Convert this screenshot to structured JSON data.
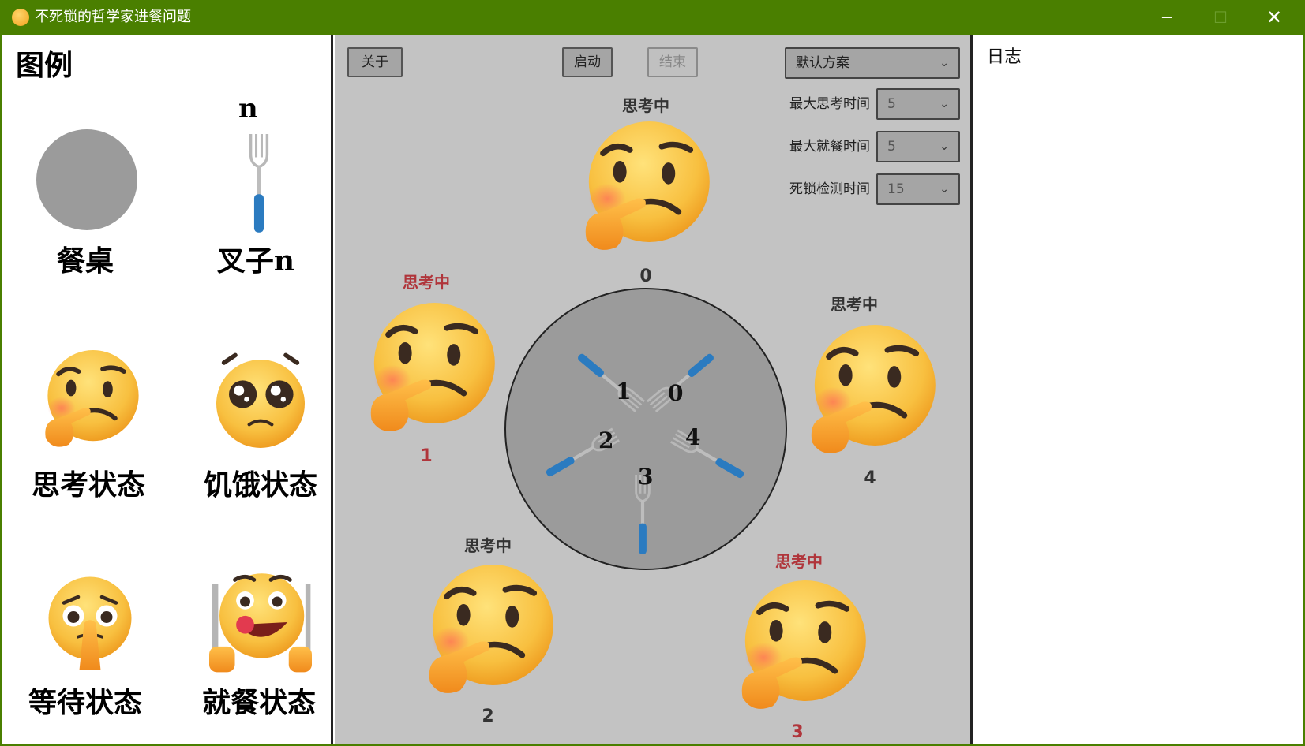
{
  "window": {
    "title": "不死锁的哲学家进餐问题",
    "minimize": "─",
    "maximize": "☐",
    "close": "✕"
  },
  "legend": {
    "title": "图例",
    "table_label": "餐桌",
    "fork_top": "n",
    "fork_label": "叉子n",
    "thinking_label": "思考状态",
    "hungry_label": "饥饿状态",
    "waiting_label": "等待状态",
    "eating_label": "就餐状态"
  },
  "toolbar": {
    "about": "关于",
    "start": "启动",
    "stop": "结束",
    "scheme": "默认方案",
    "max_think_label": "最大思考时间",
    "max_think": "5",
    "max_eat_label": "最大就餐时间",
    "max_eat": "5",
    "deadlock_label": "死锁检测时间",
    "deadlock": "15"
  },
  "philosophers": [
    {
      "id": "0",
      "status": "思考中",
      "highlight": false
    },
    {
      "id": "1",
      "status": "思考中",
      "highlight": true
    },
    {
      "id": "2",
      "status": "思考中",
      "highlight": false
    },
    {
      "id": "3",
      "status": "思考中",
      "highlight": true
    },
    {
      "id": "4",
      "status": "思考中",
      "highlight": false
    }
  ],
  "forks": [
    "0",
    "1",
    "2",
    "3",
    "4"
  ],
  "log": {
    "title": "日志"
  },
  "colors": {
    "titlebar": "#4a7f00",
    "highlight": "#b0353b",
    "panel": "#c3c3c3",
    "table": "#9b9b9b",
    "fork_handle": "#2b7bc0"
  }
}
